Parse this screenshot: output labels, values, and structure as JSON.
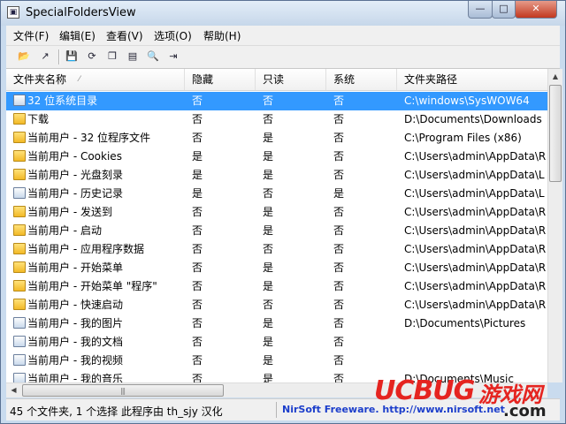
{
  "window": {
    "title": "SpecialFoldersView"
  },
  "window_buttons": {
    "min": "—",
    "max": "□",
    "close": "✕"
  },
  "menu": [
    "文件(F)",
    "编辑(E)",
    "查看(V)",
    "选项(O)",
    "帮助(H)"
  ],
  "toolbar": {
    "buttons": [
      {
        "name": "open-folder-icon",
        "glyph": "📂"
      },
      {
        "name": "open-explorer-icon",
        "glyph": "↗"
      },
      {
        "name": "save-icon",
        "glyph": "💾"
      },
      {
        "name": "refresh-icon",
        "glyph": "⟳"
      },
      {
        "name": "copy-icon",
        "glyph": "❐"
      },
      {
        "name": "properties-icon",
        "glyph": "▤"
      },
      {
        "name": "find-icon",
        "glyph": "🔍"
      },
      {
        "name": "exit-icon",
        "glyph": "⇥"
      }
    ]
  },
  "columns": [
    "文件夹名称",
    "隐藏",
    "只读",
    "系统",
    "文件夹路径"
  ],
  "rows": [
    {
      "name": "32 位系统目录",
      "hidden": "否",
      "readonly": "否",
      "system": "否",
      "path": "C:\\windows\\SysWOW64",
      "icon": "special",
      "selected": true
    },
    {
      "name": "下载",
      "hidden": "否",
      "readonly": "否",
      "system": "否",
      "path": "D:\\Documents\\Downloads",
      "icon": "folder"
    },
    {
      "name": "当前用户 - 32 位程序文件",
      "hidden": "否",
      "readonly": "是",
      "system": "否",
      "path": "C:\\Program Files (x86)",
      "icon": "folder"
    },
    {
      "name": "当前用户 - Cookies",
      "hidden": "是",
      "readonly": "是",
      "system": "否",
      "path": "C:\\Users\\admin\\AppData\\R",
      "icon": "folder"
    },
    {
      "name": "当前用户 - 光盘刻录",
      "hidden": "是",
      "readonly": "是",
      "system": "否",
      "path": "C:\\Users\\admin\\AppData\\L",
      "icon": "folder"
    },
    {
      "name": "当前用户 - 历史记录",
      "hidden": "是",
      "readonly": "否",
      "system": "是",
      "path": "C:\\Users\\admin\\AppData\\L",
      "icon": "special"
    },
    {
      "name": "当前用户 - 发送到",
      "hidden": "否",
      "readonly": "是",
      "system": "否",
      "path": "C:\\Users\\admin\\AppData\\R",
      "icon": "folder"
    },
    {
      "name": "当前用户 - 启动",
      "hidden": "否",
      "readonly": "是",
      "system": "否",
      "path": "C:\\Users\\admin\\AppData\\R",
      "icon": "folder"
    },
    {
      "name": "当前用户 - 应用程序数据",
      "hidden": "否",
      "readonly": "否",
      "system": "否",
      "path": "C:\\Users\\admin\\AppData\\R",
      "icon": "folder"
    },
    {
      "name": "当前用户 - 开始菜单",
      "hidden": "否",
      "readonly": "是",
      "system": "否",
      "path": "C:\\Users\\admin\\AppData\\R",
      "icon": "folder"
    },
    {
      "name": "当前用户 - 开始菜单 \"程序\"",
      "hidden": "否",
      "readonly": "是",
      "system": "否",
      "path": "C:\\Users\\admin\\AppData\\R",
      "icon": "folder"
    },
    {
      "name": "当前用户 - 快速启动",
      "hidden": "否",
      "readonly": "否",
      "system": "否",
      "path": "C:\\Users\\admin\\AppData\\R",
      "icon": "folder"
    },
    {
      "name": "当前用户 - 我的图片",
      "hidden": "否",
      "readonly": "是",
      "system": "否",
      "path": "D:\\Documents\\Pictures",
      "icon": "special"
    },
    {
      "name": "当前用户 - 我的文档",
      "hidden": "否",
      "readonly": "是",
      "system": "否",
      "path": "",
      "icon": "special"
    },
    {
      "name": "当前用户 - 我的视频",
      "hidden": "否",
      "readonly": "是",
      "system": "否",
      "path": "",
      "icon": "special"
    },
    {
      "name": "当前用户 - 我的音乐",
      "hidden": "否",
      "readonly": "是",
      "system": "否",
      "path": "D:\\Documents\\Music",
      "icon": "special"
    }
  ],
  "status": {
    "text": "45 个文件夹, 1 个选择   此程序由 th_sjy 汉化",
    "link": "NirSoft Freeware.  http://www.nirsoft.net"
  },
  "watermark": {
    "brand": "UCBUG",
    "cn": "游戏网",
    "domain": ".com"
  },
  "scroll": {
    "grip": "|||"
  }
}
